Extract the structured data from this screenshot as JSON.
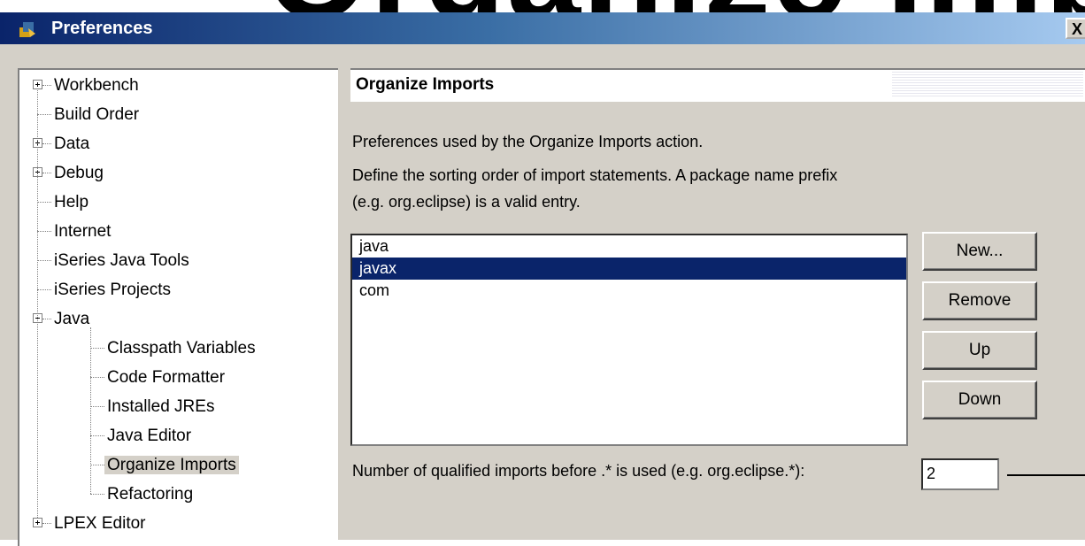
{
  "background_text": "Organize Imports",
  "window": {
    "title": "Preferences",
    "close": "X"
  },
  "tree": {
    "items": [
      {
        "label": "Workbench",
        "expander": "plus"
      },
      {
        "label": "Build Order"
      },
      {
        "label": "Data",
        "expander": "plus"
      },
      {
        "label": "Debug",
        "expander": "plus"
      },
      {
        "label": "Help"
      },
      {
        "label": "Internet"
      },
      {
        "label": "iSeries Java Tools"
      },
      {
        "label": "iSeries Projects"
      },
      {
        "label": "Java",
        "expander": "minus"
      },
      {
        "label": "Classpath Variables"
      },
      {
        "label": "Code Formatter"
      },
      {
        "label": "Installed JREs"
      },
      {
        "label": "Java Editor"
      },
      {
        "label": "Organize Imports",
        "selected": true
      },
      {
        "label": "Refactoring"
      },
      {
        "label": "LPEX Editor",
        "expander": "plus"
      }
    ]
  },
  "page": {
    "title": "Organize Imports",
    "description": "Preferences used by the Organize Imports action.",
    "instructions_line1": "Define the sorting order of import statements. A package name prefix",
    "instructions_line2": "(e.g. org.eclipse) is a valid entry.",
    "list": {
      "items": [
        "java",
        "javax",
        "com"
      ],
      "selected": "javax"
    },
    "buttons": {
      "new": "New...",
      "remove": "Remove",
      "up": "Up",
      "down": "Down"
    },
    "threshold_label": "Number of qualified imports before .* is used (e.g. org.eclipse.*):",
    "threshold_value": "2"
  },
  "colors": {
    "titlebar_start": "#0a246a",
    "titlebar_end": "#a6caf0",
    "selection": "#0a246a",
    "dialog_face": "#d4d0c8"
  }
}
